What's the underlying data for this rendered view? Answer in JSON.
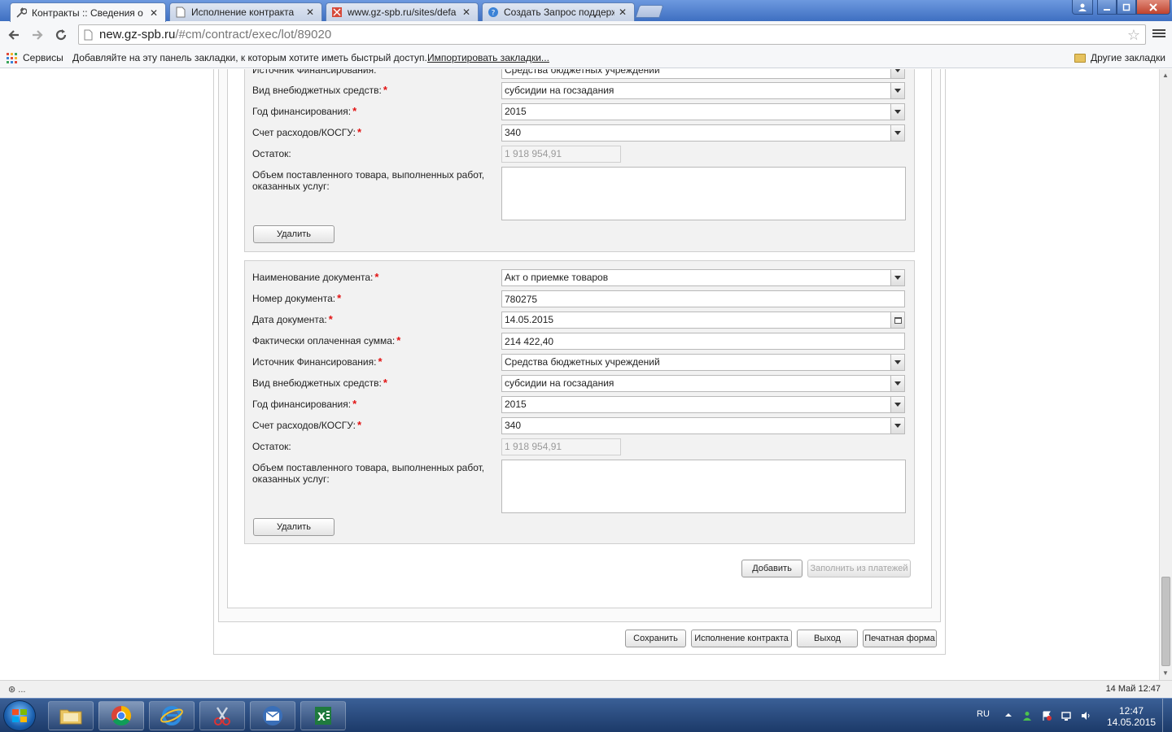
{
  "browser": {
    "tabs": [
      {
        "title": "Контракты :: Сведения о",
        "active": true
      },
      {
        "title": "Исполнение контракта",
        "active": false
      },
      {
        "title": "www.gz-spb.ru/sites/defa",
        "active": false
      },
      {
        "title": "Создать Запрос поддерж",
        "active": false
      }
    ],
    "close_glyph": "✕",
    "url_domain": "new.gz-spb.ru",
    "url_path": "/#cm/contract/exec/lot/89020"
  },
  "bookmarks": {
    "apps_label": "Сервисы",
    "hint": "Добавляйте на эту панель закладки, к которым хотите иметь быстрый доступ.",
    "import_link": "Импортировать закладки...",
    "other_label": "Другие закладки"
  },
  "form": {
    "required_mark": "*",
    "block1": {
      "source_label": "Источник Финансирования:",
      "source_value": "Средства бюджетных учреждений",
      "fund_type_label": "Вид внебюджетных средств:",
      "fund_type_value": "субсидии на госзадания",
      "year_label": "Год финансирования:",
      "year_value": "2015",
      "account_label": "Счет расходов/КОСГУ:",
      "account_value": "340",
      "balance_label": "Остаток:",
      "balance_value": "1 918 954,91",
      "volume_label": "Объем поставленного товара, выполненных работ, оказанных услуг:",
      "delete_button": "Удалить"
    },
    "block2": {
      "doc_name_label": "Наименование документа:",
      "doc_name_value": "Акт о приемке товаров",
      "doc_number_label": "Номер документа:",
      "doc_number_value": "780275",
      "doc_date_label": "Дата документа:",
      "doc_date_value": "14.05.2015",
      "paid_label": "Фактически оплаченная сумма:",
      "paid_value": "214 422,40",
      "source_label": "Источник Финансирования:",
      "source_value": "Средства бюджетных учреждений",
      "fund_type_label": "Вид внебюджетных средств:",
      "fund_type_value": "субсидии на госзадания",
      "year_label": "Год финансирования:",
      "year_value": "2015",
      "account_label": "Счет расходов/КОСГУ:",
      "account_value": "340",
      "balance_label": "Остаток:",
      "balance_value": "1 918 954,91",
      "volume_label": "Объем поставленного товара, выполненных работ, оказанных услуг:",
      "delete_button": "Удалить"
    },
    "add_button": "Добавить",
    "fill_button": "Заполнить из платежей",
    "save_button": "Сохранить",
    "exec_button": "Исполнение контракта",
    "exit_button": "Выход",
    "print_button": "Печатная форма"
  },
  "statusbar": {
    "left": "⊛ ...",
    "right": "14 Май 12:47"
  },
  "taskbar": {
    "lang": "RU",
    "time": "12:47",
    "date": "14.05.2015"
  },
  "colors": {
    "required": "#e21313",
    "taskbar": "#1c3a69",
    "tabstrip": "#4a7ccc"
  }
}
